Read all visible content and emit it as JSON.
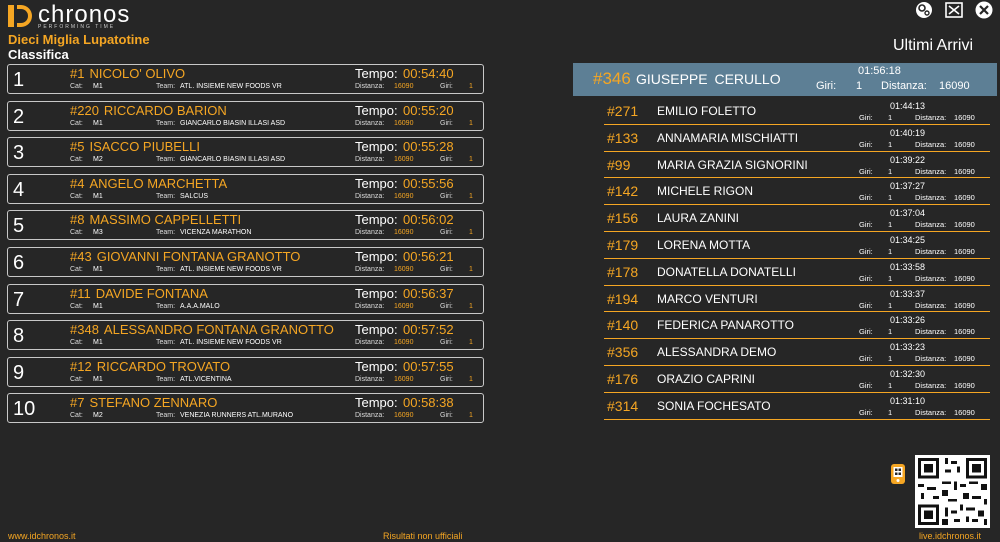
{
  "header": {
    "logo_text": "chronos",
    "logo_sub": "PERFORMING TIME",
    "event_title": "Dieci Miglia Lupatotine",
    "section_title": "Classifica",
    "arrivals_title": "Ultimi Arrivi"
  },
  "icons": {
    "settings": "gear-icon",
    "window": "window-icon",
    "close": "close-icon",
    "phone": "phone-icon",
    "qr": "qr-code-icon"
  },
  "labels": {
    "cat": "Cat:",
    "team": "Team:",
    "distanza": "Distanza:",
    "giri": "Giri:",
    "tempo": "Tempo:"
  },
  "ranking": [
    {
      "pos": "1",
      "num": "#1",
      "name": "NICOLO' OLIVO",
      "cat": "M1",
      "team": "ATL. INSIEME NEW FOODS VR",
      "distanza": "16090",
      "giri": "1",
      "tempo": "00:54:40"
    },
    {
      "pos": "2",
      "num": "#220",
      "name": "RICCARDO BARION",
      "cat": "M1",
      "team": "GIANCARLO BIASIN ILLASI ASD",
      "distanza": "16090",
      "giri": "1",
      "tempo": "00:55:20"
    },
    {
      "pos": "3",
      "num": "#5",
      "name": "ISACCO PIUBELLI",
      "cat": "M2",
      "team": "GIANCARLO BIASIN ILLASI ASD",
      "distanza": "16090",
      "giri": "1",
      "tempo": "00:55:28"
    },
    {
      "pos": "4",
      "num": "#4",
      "name": "ANGELO MARCHETTA",
      "cat": "M1",
      "team": "SALCUS",
      "distanza": "16090",
      "giri": "1",
      "tempo": "00:55:56"
    },
    {
      "pos": "5",
      "num": "#8",
      "name": "MASSIMO CAPPELLETTI",
      "cat": "M3",
      "team": "VICENZA MARATHON",
      "distanza": "16090",
      "giri": "1",
      "tempo": "00:56:02"
    },
    {
      "pos": "6",
      "num": "#43",
      "name": "GIOVANNI FONTANA GRANOTTO",
      "cat": "M1",
      "team": "ATL. INSIEME NEW FOODS VR",
      "distanza": "16090",
      "giri": "1",
      "tempo": "00:56:21"
    },
    {
      "pos": "7",
      "num": "#11",
      "name": "DAVIDE FONTANA",
      "cat": "M1",
      "team": "A.A.A.MALO",
      "distanza": "16090",
      "giri": "1",
      "tempo": "00:56:37"
    },
    {
      "pos": "8",
      "num": "#348",
      "name": "ALESSANDRO FONTANA GRANOTTO",
      "cat": "M1",
      "team": "ATL. INSIEME NEW FOODS VR",
      "distanza": "16090",
      "giri": "1",
      "tempo": "00:57:52"
    },
    {
      "pos": "9",
      "num": "#12",
      "name": "RICCARDO TROVATO",
      "cat": "M1",
      "team": "ATL.VICENTINA",
      "distanza": "16090",
      "giri": "1",
      "tempo": "00:57:55"
    },
    {
      "pos": "10",
      "num": "#7",
      "name": "STEFANO ZENNARO",
      "cat": "M2",
      "team": "VENEZIA RUNNERS ATL.MURANO",
      "distanza": "16090",
      "giri": "1",
      "tempo": "00:58:38"
    }
  ],
  "latest": {
    "num": "#346",
    "name": "GIUSEPPE  CERULLO",
    "time": "01:56:18",
    "giri_label": "Giri:",
    "giri": "1",
    "distanza_label": "Distanza:",
    "distanza": "16090"
  },
  "arrivals": [
    {
      "num": "#271",
      "name": "EMILIO FOLETTO",
      "time": "01:44:13",
      "giri": "1",
      "distanza": "16090"
    },
    {
      "num": "#133",
      "name": "ANNAMARIA MISCHIATTI",
      "time": "01:40:19",
      "giri": "1",
      "distanza": "16090"
    },
    {
      "num": "#99",
      "name": "MARIA GRAZIA SIGNORINI",
      "time": "01:39:22",
      "giri": "1",
      "distanza": "16090"
    },
    {
      "num": "#142",
      "name": "MICHELE RIGON",
      "time": "01:37:27",
      "giri": "1",
      "distanza": "16090"
    },
    {
      "num": "#156",
      "name": "LAURA ZANINI",
      "time": "01:37:04",
      "giri": "1",
      "distanza": "16090"
    },
    {
      "num": "#179",
      "name": "LORENA MOTTA",
      "time": "01:34:25",
      "giri": "1",
      "distanza": "16090"
    },
    {
      "num": "#178",
      "name": "DONATELLA DONATELLI",
      "time": "01:33:58",
      "giri": "1",
      "distanza": "16090"
    },
    {
      "num": "#194",
      "name": "MARCO VENTURI",
      "time": "01:33:37",
      "giri": "1",
      "distanza": "16090"
    },
    {
      "num": "#140",
      "name": "FEDERICA PANAROTTO",
      "time": "01:33:26",
      "giri": "1",
      "distanza": "16090"
    },
    {
      "num": "#356",
      "name": "ALESSANDRA DEMO",
      "time": "01:33:23",
      "giri": "1",
      "distanza": "16090"
    },
    {
      "num": "#176",
      "name": "ORAZIO CAPRINI",
      "time": "01:32:30",
      "giri": "1",
      "distanza": "16090"
    },
    {
      "num": "#314",
      "name": "SONIA FOCHESATO",
      "time": "01:31:10",
      "giri": "1",
      "distanza": "16090"
    }
  ],
  "footer": {
    "left": "www.idchronos.it",
    "middle": "Risultati non ufficiali",
    "right": "live.idchronos.it"
  },
  "colors": {
    "background": "#262626",
    "accent": "#f5a623",
    "highlight": "#5d7f95",
    "border": "#c8c8c8"
  }
}
